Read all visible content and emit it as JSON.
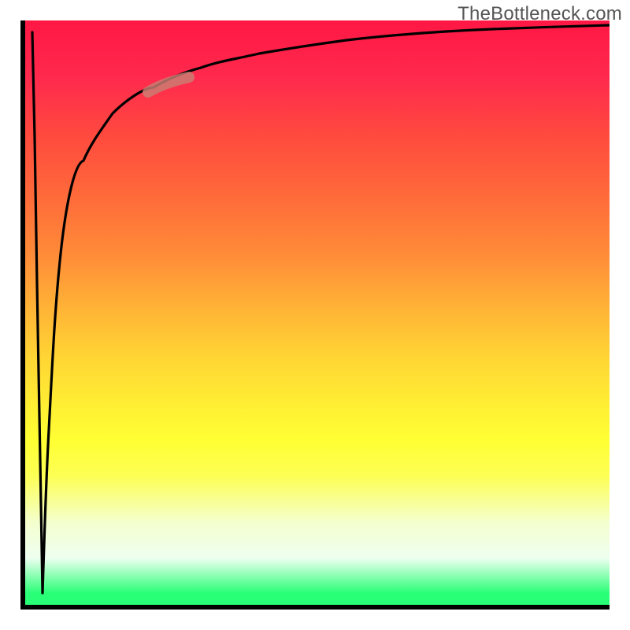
{
  "attribution": "TheBottleneck.com",
  "colors": {
    "axis": "#000000",
    "curve": "#000000",
    "highlight": "#c97f74",
    "gradient_top": "#ff1744",
    "gradient_mid": "#ffe633",
    "gradient_bottom": "#29ff76",
    "attribution_text": "#555555"
  },
  "chart_data": {
    "type": "line",
    "title": "",
    "xlabel": "",
    "ylabel": "",
    "xlim": [
      0,
      100
    ],
    "ylim": [
      0,
      100
    ],
    "axes_visible": true,
    "grid": false,
    "legend": false,
    "series": [
      {
        "name": "bottleneck-curve-right",
        "comment": "Main asymptotic curve: dives to ~0 near the left wall then rises sharply and flattens toward ~96 at the right edge. Values in percent of axis range.",
        "x": [
          3.0,
          3.5,
          4.0,
          5.0,
          6.0,
          8.0,
          10.0,
          12.0,
          15.0,
          18.0,
          22.0,
          26.0,
          30.0,
          36.0,
          44.0,
          55.0,
          70.0,
          85.0,
          100.0
        ],
        "y": [
          2.0,
          10.0,
          30.0,
          50.0,
          60.0,
          70.0,
          76.0,
          80.0,
          84.0,
          86.5,
          88.6,
          90.0,
          91.2,
          92.4,
          93.5,
          94.4,
          95.1,
          95.6,
          96.0
        ]
      },
      {
        "name": "bottleneck-curve-left",
        "comment": "Short near-vertical stroke hugging the y-axis forming the left side of the cusp.",
        "x": [
          1.2,
          1.6,
          2.0,
          2.5,
          3.0
        ],
        "y": [
          98.0,
          80.0,
          55.0,
          25.0,
          2.0
        ]
      }
    ],
    "highlight_segment": {
      "comment": "Pale brick-red lozenge overlaid on the curve roughly around x≈22–27.",
      "x_range": [
        21,
        28
      ],
      "y_range": [
        87.8,
        90.3
      ]
    }
  }
}
